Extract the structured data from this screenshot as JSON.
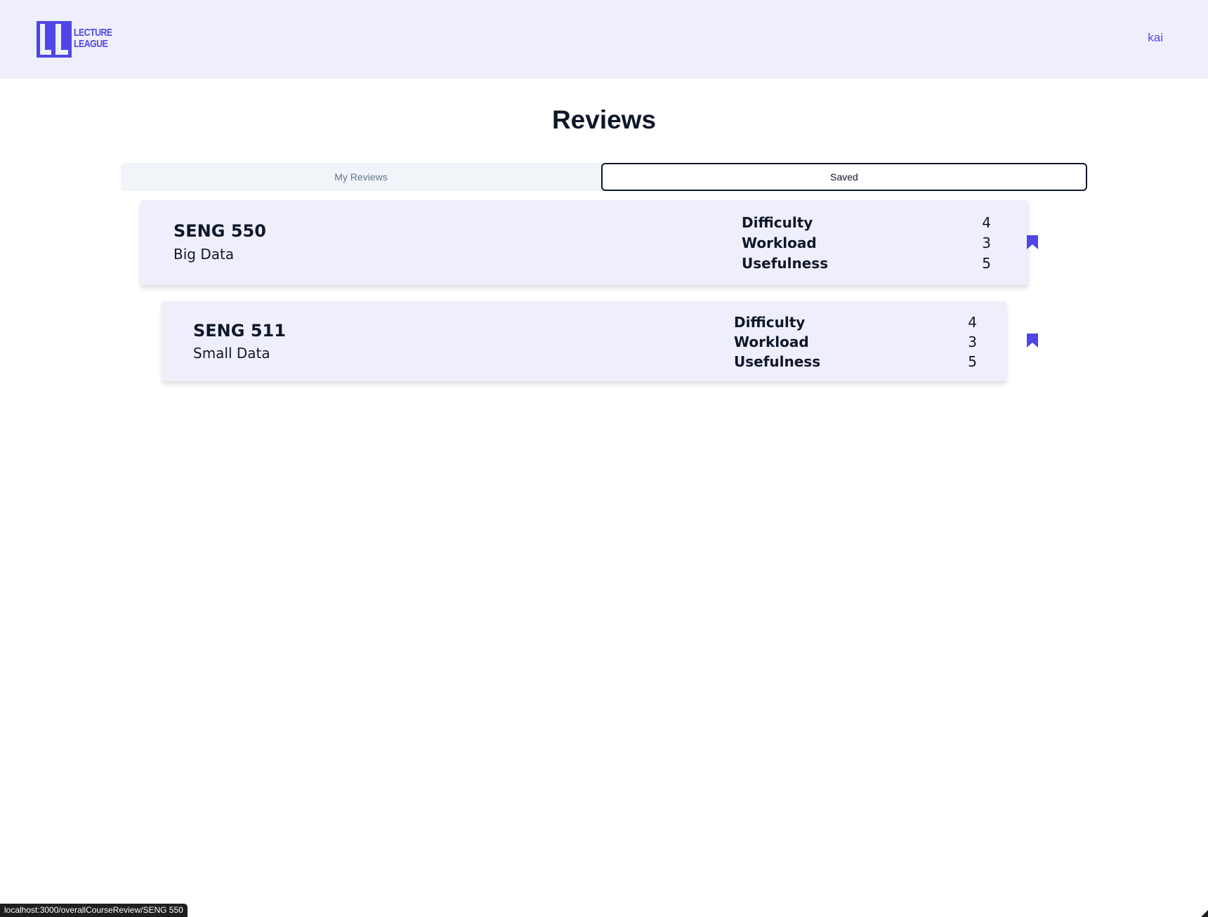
{
  "header": {
    "logo": {
      "icon": "lecture-league-logo-icon",
      "line1": "LECTURE",
      "line2": "LEAGUE",
      "color": "#4f46e5"
    },
    "user": "kai",
    "background": "#eeeffb"
  },
  "page": {
    "title": "Reviews"
  },
  "tabs": [
    {
      "label": "My Reviews",
      "active": false
    },
    {
      "label": "Saved",
      "active": true
    }
  ],
  "reviews": [
    {
      "code": "SENG 550",
      "name": "Big Data",
      "ratings": [
        {
          "label": "Difficulty",
          "value": "4"
        },
        {
          "label": "Workload",
          "value": "3"
        },
        {
          "label": "Usefulness",
          "value": "5"
        }
      ],
      "bookmark_icon": "bookmark-filled-icon",
      "saved": true
    },
    {
      "code": "SENG 511",
      "name": "Small Data",
      "ratings": [
        {
          "label": "Difficulty",
          "value": "4"
        },
        {
          "label": "Workload",
          "value": "3"
        },
        {
          "label": "Usefulness",
          "value": "5"
        }
      ],
      "bookmark_icon": "bookmark-filled-icon",
      "saved": true
    }
  ],
  "status_bar": {
    "url": "localhost:3000/overallCourseReview/SENG 550"
  },
  "colors": {
    "accent": "#4f46e5",
    "card_background": "#eeeffb",
    "text": "#0f172a"
  }
}
